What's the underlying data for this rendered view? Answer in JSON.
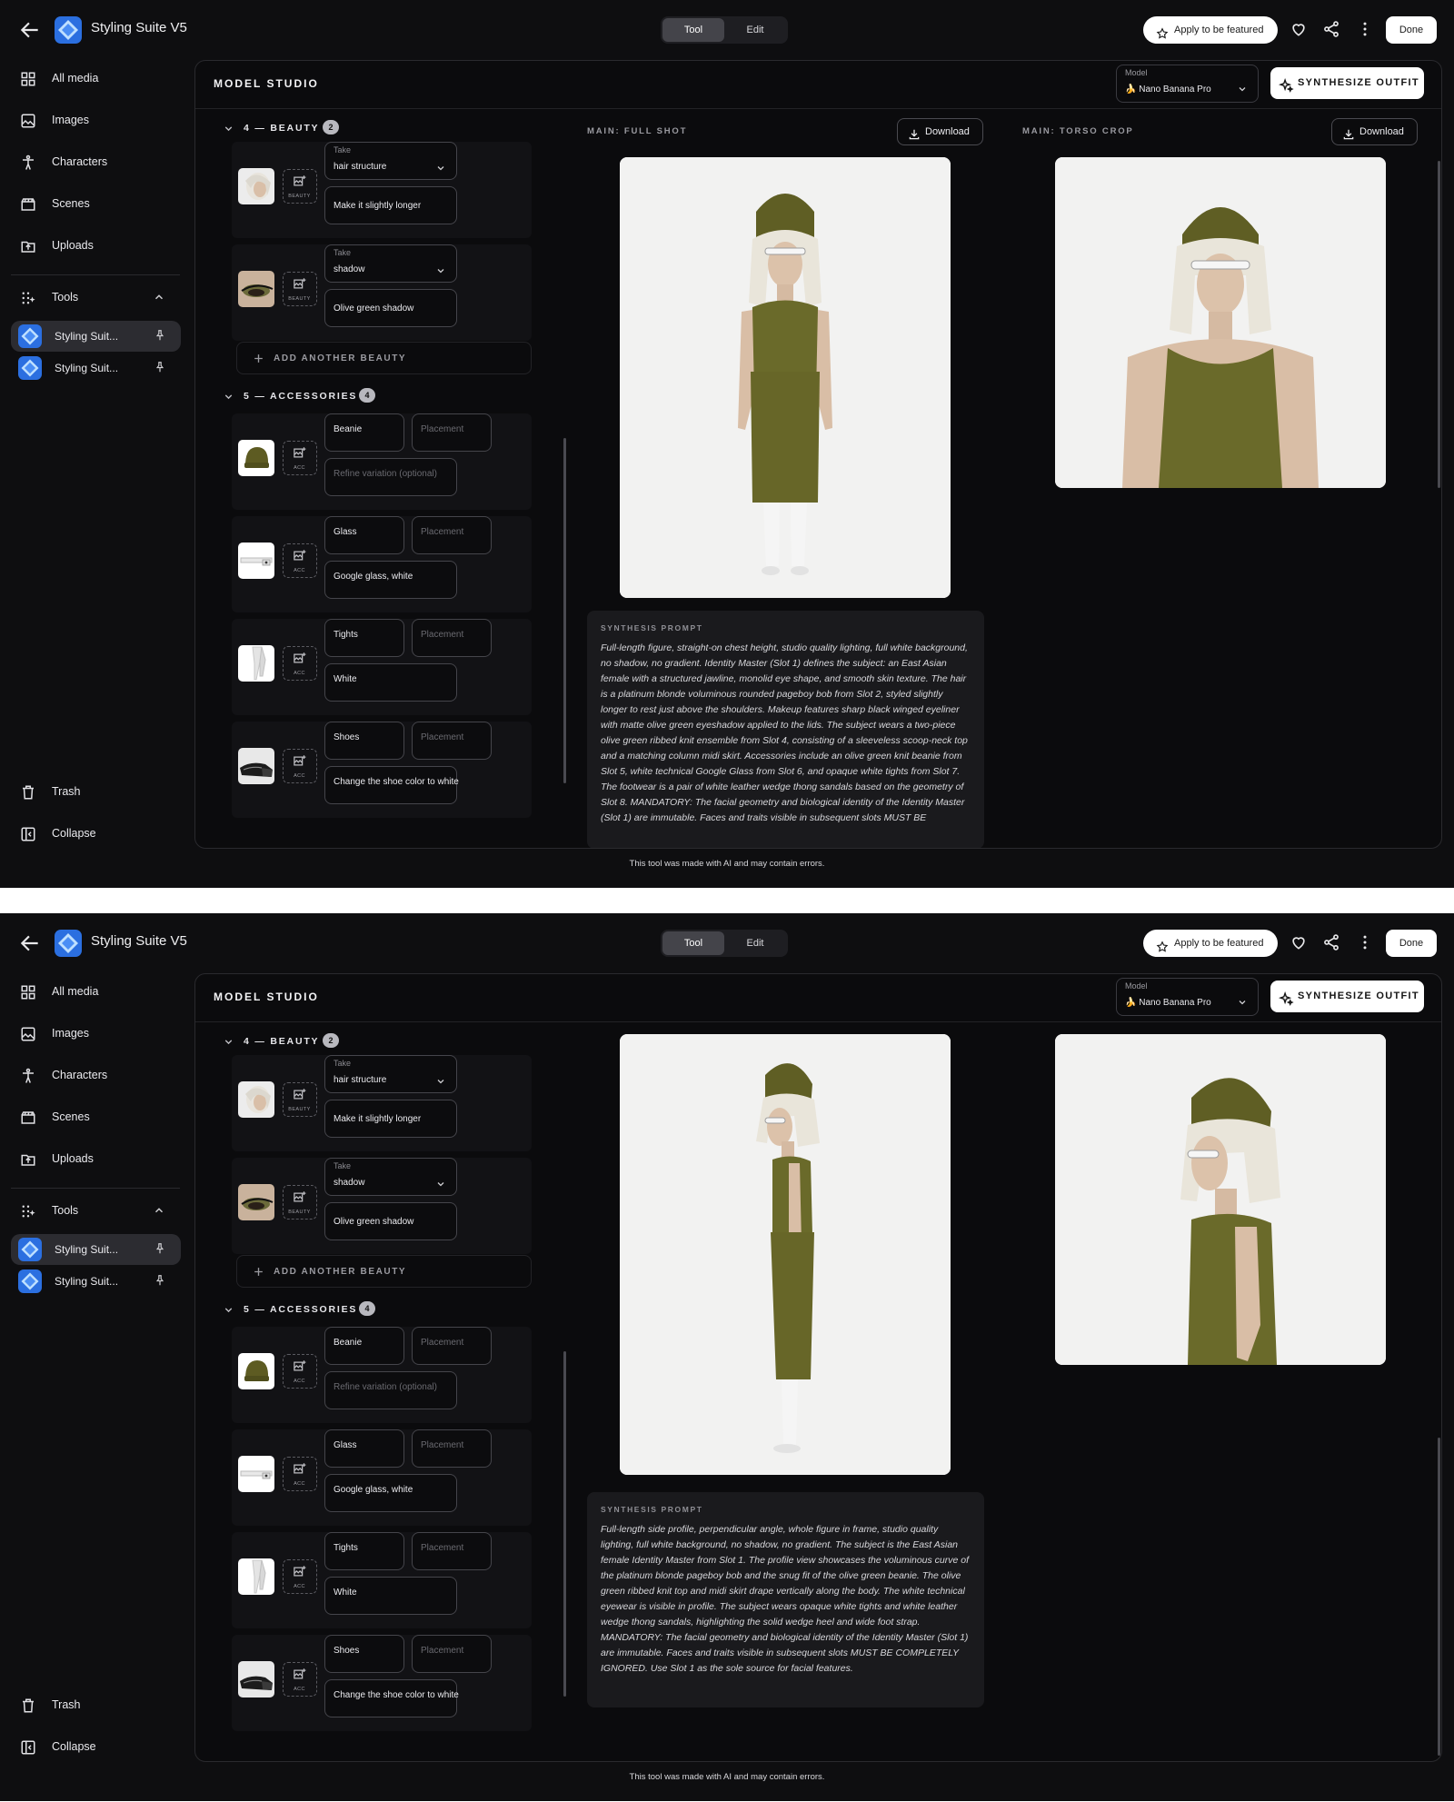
{
  "app": {
    "title": "Styling Suite V5"
  },
  "topbar": {
    "modes": [
      "Tool",
      "Edit"
    ],
    "feature_label": "Apply to be featured",
    "done_label": "Done",
    "icons": [
      "back-arrow-icon",
      "heart-icon",
      "share-icon",
      "more-vert-icon"
    ]
  },
  "sidebar": {
    "nav": [
      "All media",
      "Images",
      "Characters",
      "Scenes",
      "Uploads"
    ],
    "tools_label": "Tools",
    "tools": [
      "Styling Suit...",
      "Styling Suit..."
    ],
    "trash_label": "Trash",
    "collapse_label": "Collapse"
  },
  "panel": {
    "title": "MODEL STUDIO",
    "model_label": "Model",
    "model_value": "🍌 Nano Banana Pro",
    "synthesize_label": "SYNTHESIZE OUTFIT"
  },
  "beauty": {
    "title": "4 — BEAUTY",
    "count": "2",
    "rows": [
      {
        "take_label": "Take",
        "take_value": "hair structure",
        "note": "Make it slightly longer",
        "slot_tag": "BEAUTY"
      },
      {
        "take_label": "Take",
        "take_value": "shadow",
        "note": "Olive green shadow",
        "slot_tag": "BEAUTY"
      }
    ],
    "add_label": "ADD ANOTHER BEAUTY"
  },
  "accessories": {
    "title": "5 — ACCESSORIES",
    "count": "4",
    "rows": [
      {
        "name": "Beanie",
        "placement": "Placement",
        "note": "",
        "note_placeholder": "Refine variation (optional)",
        "slot_tag": "ACC"
      },
      {
        "name": "Glass",
        "placement": "Placement",
        "note": "Google glass, white",
        "slot_tag": "ACC"
      },
      {
        "name": "Tights",
        "placement": "Placement",
        "note": "White",
        "slot_tag": "ACC"
      },
      {
        "name": "Shoes",
        "placement": "Placement",
        "note": "Change the shoe color to white",
        "slot_tag": "ACC"
      }
    ]
  },
  "outputs": {
    "full_label": "MAIN: FULL SHOT",
    "torso_label": "MAIN: TORSO CROP",
    "download_label": "Download"
  },
  "prompt_label": "SYNTHESIS PROMPT",
  "prompts": [
    "Full-length figure, straight-on chest height, studio quality lighting, full white background, no shadow, no gradient. Identity Master (Slot 1) defines the subject: an East Asian female with a structured jawline, monolid eye shape, and smooth skin texture. The hair is a platinum blonde voluminous rounded pageboy bob from Slot 2, styled slightly longer to rest just above the shoulders. Makeup features sharp black winged eyeliner with matte olive green eyeshadow applied to the lids. The subject wears a two-piece olive green ribbed knit ensemble from Slot 4, consisting of a sleeveless scoop-neck top and a matching column midi skirt. Accessories include an olive green knit beanie from Slot 5, white technical Google Glass from Slot 6, and opaque white tights from Slot 7. The footwear is a pair of white leather wedge thong sandals based on the geometry of Slot 8. MANDATORY: The facial geometry and biological identity of the Identity Master (Slot 1) are immutable. Faces and traits visible in subsequent slots MUST BE",
    "Full-length side profile, perpendicular angle, whole figure in frame, studio quality lighting, full white background, no shadow, no gradient. The subject is the East Asian female Identity Master from Slot 1. The profile view showcases the voluminous curve of the platinum blonde pageboy bob and the snug fit of the olive green beanie. The olive green ribbed knit top and midi skirt drape vertically along the body. The white technical eyewear is visible in profile. The subject wears opaque white tights and white leather wedge thong sandals, highlighting the solid wedge heel and wide foot strap. MANDATORY: The facial geometry and biological identity of the Identity Master (Slot 1) are immutable. Faces and traits visible in subsequent slots MUST BE COMPLETELY IGNORED. Use Slot 1 as the sole source for facial features."
  ],
  "disclaimer": "This tool was made with AI and may contain errors.",
  "colors": {
    "background": "#0e0e10",
    "panel": "#0b0b0d",
    "olive": "#6b6a2a",
    "accent_white": "#ffffff"
  }
}
